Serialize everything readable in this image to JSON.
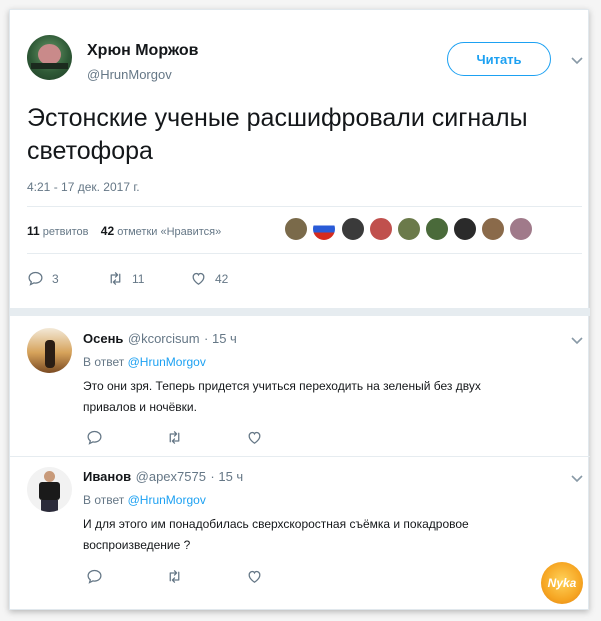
{
  "tweet": {
    "author_name": "Хрюн Моржов",
    "author_handle": "@HrunMorgov",
    "follow_label": "Читать",
    "text": "Эстонские ученые расшифровали сигналы светофора",
    "timestamp": "4:21 - 17 дек. 2017 г.",
    "retweets_count": "11",
    "retweets_label": "ретвитов",
    "likes_count": "42",
    "likes_label": "отметки «Нравится»",
    "actions": {
      "replies": "3",
      "retweets": "11",
      "likes": "42"
    }
  },
  "replies": [
    {
      "name": "Осень",
      "handle": "@kcorcisum",
      "time": "· 15 ч",
      "in_reply_prefix": "В ответ",
      "in_reply_to": "@HrunMorgov",
      "text_line1": "Это они зря. Теперь придется учиться переходить на зеленый без двух",
      "text_line2": "привалов и ночёвки."
    },
    {
      "name": "Иванов",
      "handle": "@apex7575",
      "time": "· 15 ч",
      "in_reply_prefix": "В ответ",
      "in_reply_to": "@HrunMorgov",
      "text_line1": "И для этого им понадобилась сверхскоростная съёмка и покадровое",
      "text_line2": "воспроизведение ?"
    }
  ],
  "watermark": "Nyka",
  "colors": {
    "accent": "#1da1f2",
    "secondary_text": "#657786",
    "primary_text": "#14171a"
  },
  "icons": [
    "chevron-down-icon",
    "reply-icon",
    "retweet-icon",
    "heart-icon"
  ]
}
